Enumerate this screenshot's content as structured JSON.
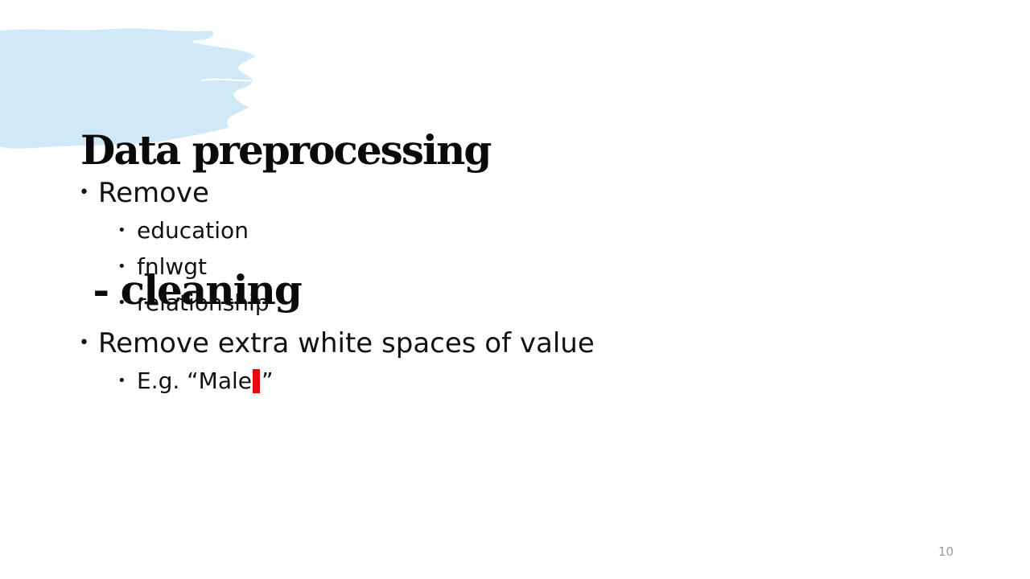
{
  "slide": {
    "title_line1": "Data preprocessing",
    "title_line2": " - cleaning",
    "bullets": [
      {
        "text": "Remove",
        "sub": [
          "education",
          "fnlwgt",
          "relationship"
        ]
      },
      {
        "text": "Remove extra white spaces of value",
        "sub_example_prefix": "E.g. “Male",
        "sub_example_suffix": "”"
      }
    ],
    "page_number": "10",
    "colors": {
      "accent_brush": "#cfeaf6",
      "highlight": "#e8070b"
    }
  }
}
